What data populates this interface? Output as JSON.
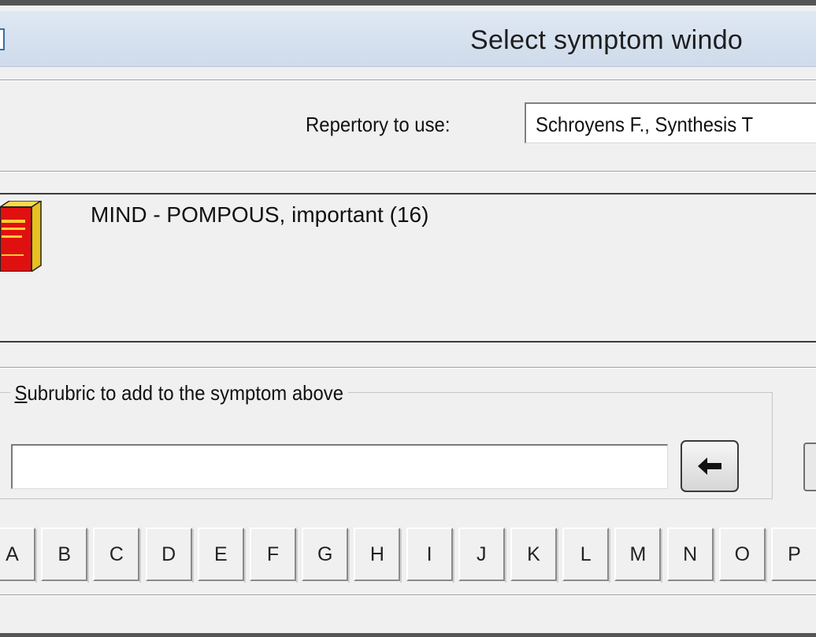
{
  "window": {
    "title": "Select symptom windo"
  },
  "repertory": {
    "label": "Repertory to use:",
    "selected": "Schroyens F., Synthesis T"
  },
  "symptom": {
    "text": "MIND - POMPOUS, important (16)",
    "icon": "book-icon"
  },
  "subrubric": {
    "legend_first": "S",
    "legend_rest": "ubrubric to add to the symptom above",
    "value": "",
    "add_button_icon": "left-arrow-icon"
  },
  "alphabet": [
    "A",
    "B",
    "C",
    "D",
    "E",
    "F",
    "G",
    "H",
    "I",
    "J",
    "K",
    "L",
    "M",
    "N",
    "O",
    "P"
  ]
}
